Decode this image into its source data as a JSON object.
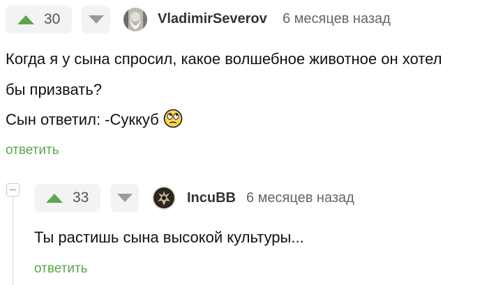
{
  "comment1": {
    "rating": "30",
    "username": "VladimirSeverov",
    "time": "6 месяцев назад",
    "lines": [
      "Когда я у сына спросил, какое волшебное животное он хотел",
      "бы призвать?",
      "Сын ответил: -Суккуб"
    ],
    "emoji": "face-with-rolling-eyes-icon",
    "reply": "ответить"
  },
  "comment2": {
    "rating": "33",
    "username": "IncuBB",
    "time": "6 месяцев назад",
    "text": "Ты растишь сына высокой культуры...",
    "reply": "ответить"
  },
  "colors": {
    "accent_green": "#5aa84a",
    "vote_bg": "#f3f3f3",
    "muted_text": "#666666"
  }
}
